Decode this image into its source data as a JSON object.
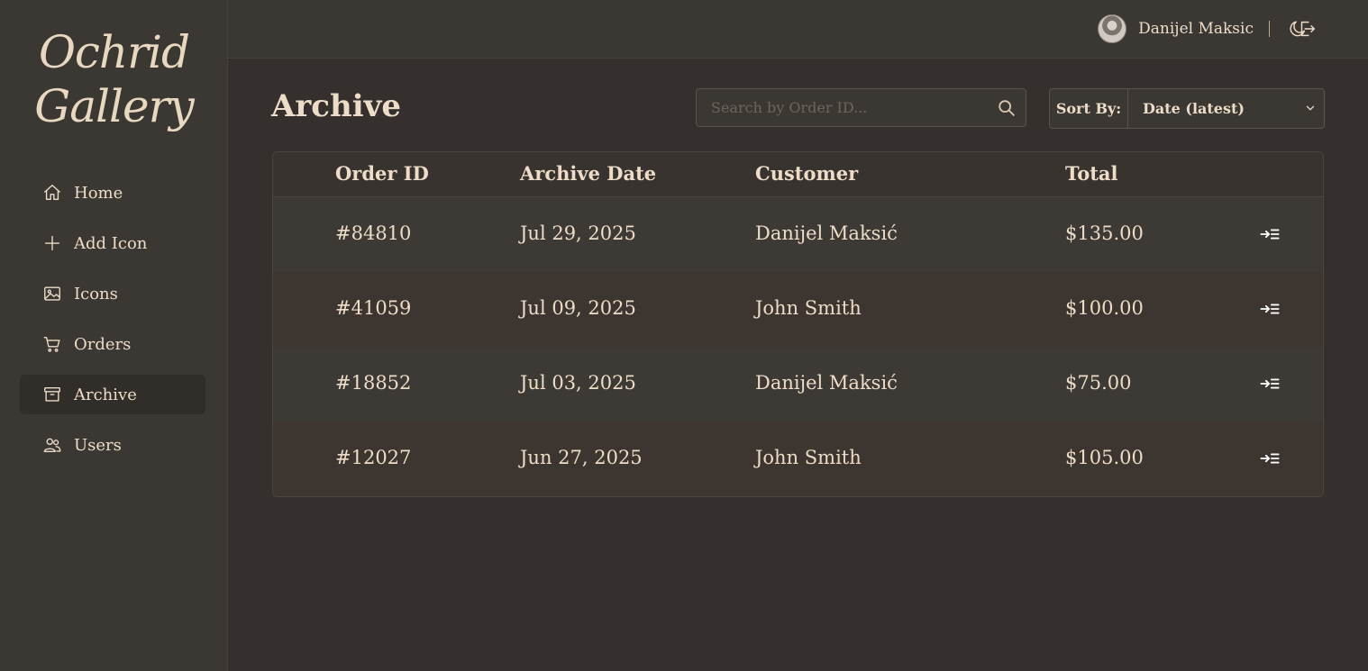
{
  "app": {
    "logo": "Ochrid Gallery"
  },
  "sidebar": {
    "items": [
      {
        "label": "Home",
        "icon": "home-icon"
      },
      {
        "label": "Add Icon",
        "icon": "plus-icon"
      },
      {
        "label": "Icons",
        "icon": "image-icon"
      },
      {
        "label": "Orders",
        "icon": "cart-icon"
      },
      {
        "label": "Archive",
        "icon": "archive-icon",
        "active": true
      },
      {
        "label": "Users",
        "icon": "users-icon"
      }
    ]
  },
  "header": {
    "user_name": "Danijel Maksic",
    "theme_icon": "moon-icon",
    "logout_icon": "logout-icon"
  },
  "main": {
    "title": "Archive",
    "search": {
      "placeholder": "Search by Order ID...",
      "value": ""
    },
    "sort": {
      "label": "Sort By:",
      "selected": "Date (latest)"
    },
    "table": {
      "columns": [
        "Order ID",
        "Archive Date",
        "Customer",
        "Total"
      ],
      "rows": [
        {
          "order_id": "#84810",
          "date": "Jul 29, 2025",
          "customer": "Danijel Maksić",
          "total": "$135.00"
        },
        {
          "order_id": "#41059",
          "date": "Jul 09, 2025",
          "customer": "John Smith",
          "total": "$100.00"
        },
        {
          "order_id": "#18852",
          "date": "Jul 03, 2025",
          "customer": "Danijel Maksić",
          "total": "$75.00"
        },
        {
          "order_id": "#12027",
          "date": "Jun 27, 2025",
          "customer": "John Smith",
          "total": "$105.00"
        }
      ]
    }
  },
  "colors": {
    "background": "#35302d",
    "sidebar": "#3b3833",
    "text": "#ecdcc8",
    "border": "#4a453f"
  }
}
